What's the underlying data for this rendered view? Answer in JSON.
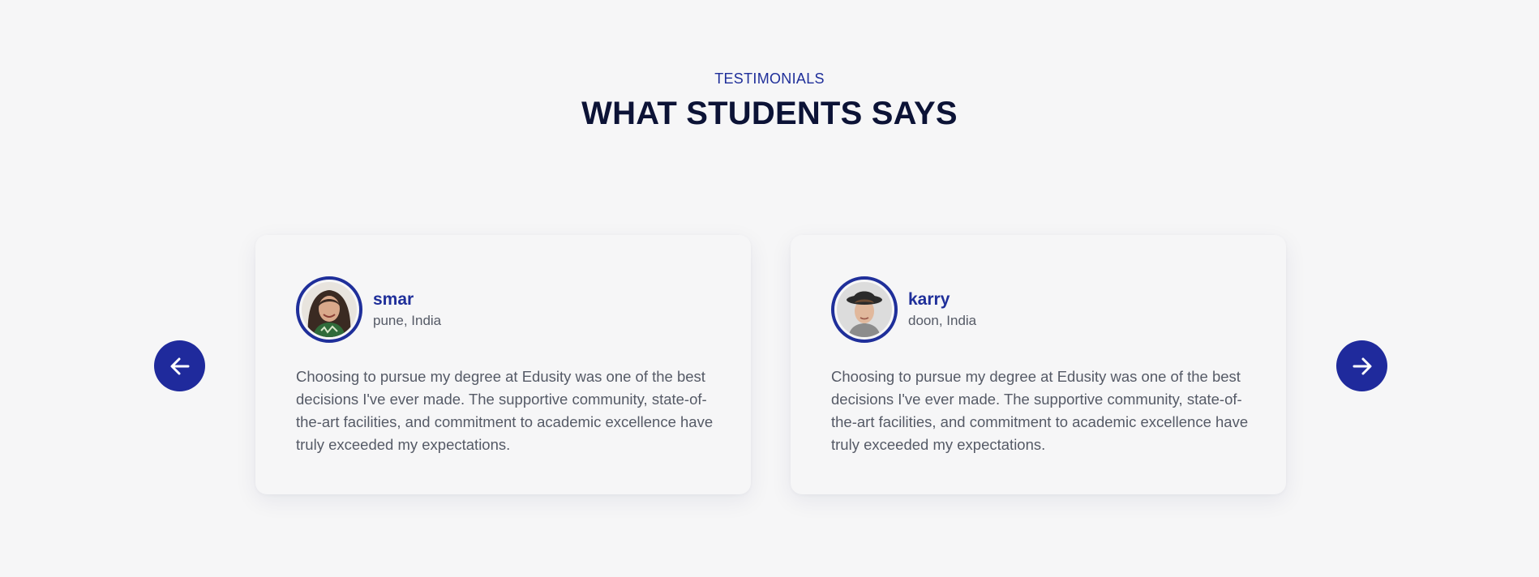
{
  "section": {
    "eyebrow": "TESTIMONIALS",
    "title": "WHAT STUDENTS SAYS"
  },
  "testimonials": [
    {
      "name": "smar",
      "location": "pune, India",
      "quote": "Choosing to pursue my degree at Edusity was one of the best decisions I've ever made. The supportive community, state-of-the-art facilities, and commitment to academic excellence have truly exceeded my expectations."
    },
    {
      "name": "karry",
      "location": "doon, India",
      "quote": "Choosing to pursue my degree at Edusity was one of the best decisions I've ever made. The supportive community, state-of-the-art facilities, and commitment to academic excellence have truly exceeded my expectations."
    }
  ],
  "controls": {
    "prev_icon": "arrow-left-icon",
    "next_icon": "arrow-right-icon"
  },
  "colors": {
    "accent": "#1f2f9a",
    "heading": "#0c1336",
    "body_text": "#555a66",
    "background": "#f6f6f7"
  }
}
